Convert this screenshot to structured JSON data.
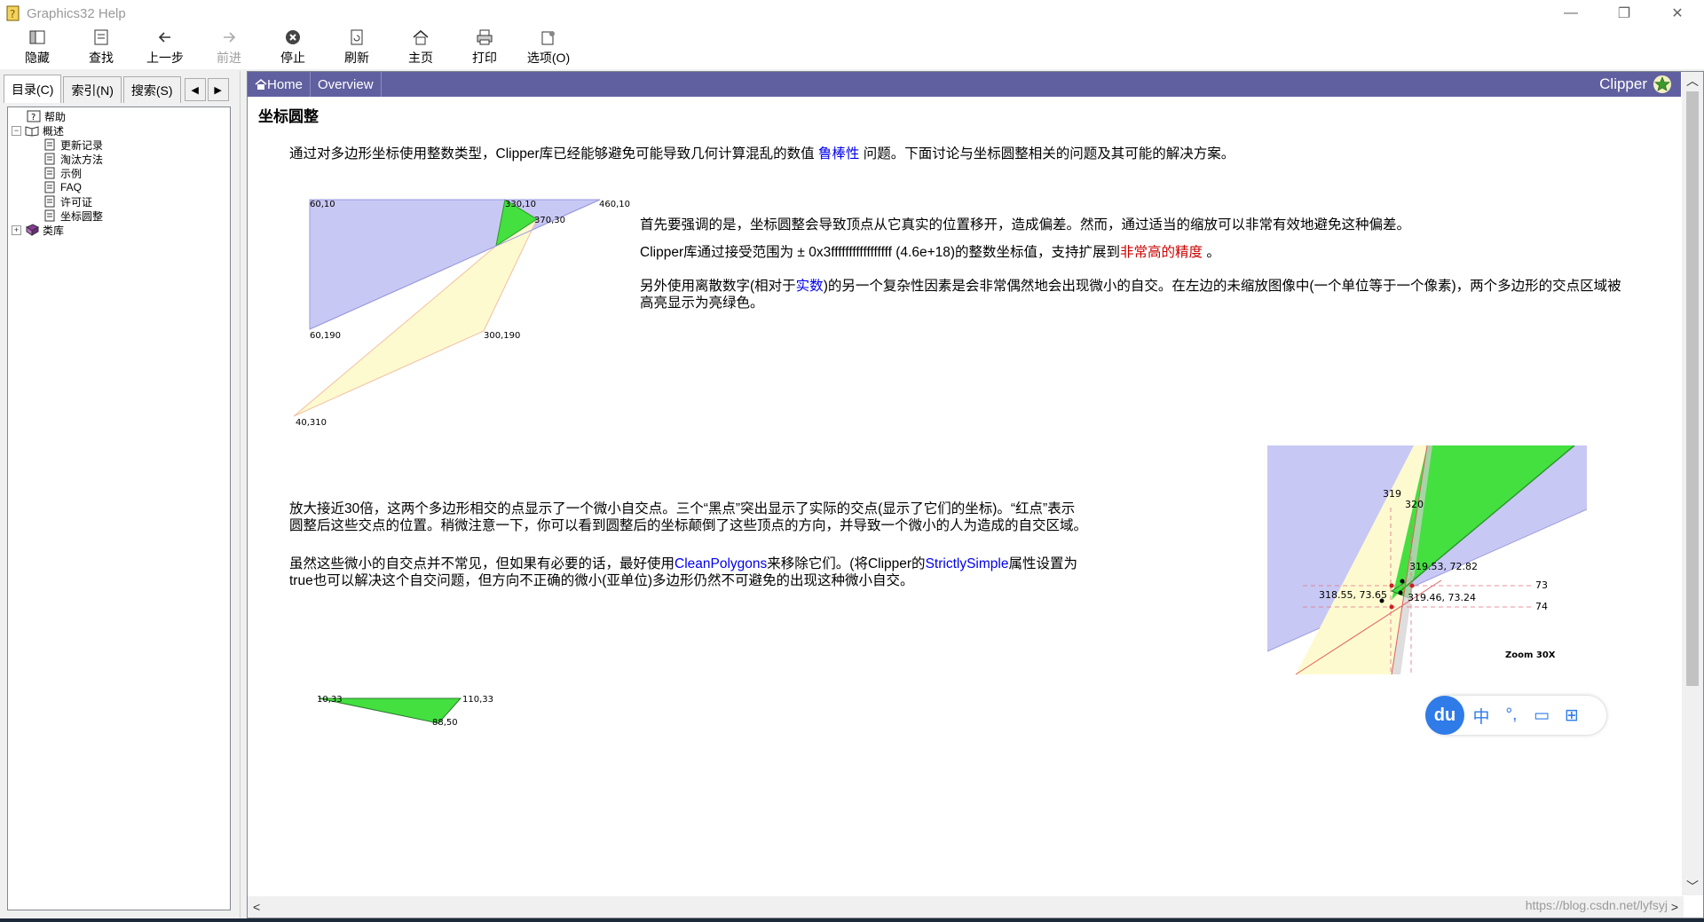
{
  "window": {
    "title": "Graphics32 Help",
    "controls": [
      "—",
      "❐",
      "✕"
    ]
  },
  "toolbar": {
    "buttons": [
      {
        "label": "隐藏",
        "icon": "hide-icon",
        "enabled": true
      },
      {
        "label": "查找",
        "icon": "find-icon",
        "enabled": true
      },
      {
        "label": "上一步",
        "icon": "back-arrow-icon",
        "enabled": true
      },
      {
        "label": "前进",
        "icon": "forward-arrow-icon",
        "enabled": false
      },
      {
        "label": "停止",
        "icon": "stop-icon",
        "enabled": true
      },
      {
        "label": "刷新",
        "icon": "refresh-icon",
        "enabled": true
      },
      {
        "label": "主页",
        "icon": "home-icon",
        "enabled": true
      },
      {
        "label": "打印",
        "icon": "print-icon",
        "enabled": true
      },
      {
        "label": "选项(O)",
        "icon": "options-icon",
        "enabled": true
      }
    ]
  },
  "sidebar": {
    "tabs": [
      {
        "label": "目录(C)",
        "active": true
      },
      {
        "label": "索引(N)",
        "active": false
      },
      {
        "label": "搜索(S)",
        "active": false
      }
    ],
    "tree": [
      {
        "label": "帮助",
        "level": 0,
        "expander": "",
        "icon": "help-book-icon"
      },
      {
        "label": "概述",
        "level": 0,
        "expander": "−",
        "icon": "open-book-icon"
      },
      {
        "label": "更新记录",
        "level": 1,
        "expander": "",
        "icon": "page-icon"
      },
      {
        "label": "淘汰方法",
        "level": 1,
        "expander": "",
        "icon": "page-icon"
      },
      {
        "label": "示例",
        "level": 1,
        "expander": "",
        "icon": "page-icon"
      },
      {
        "label": "FAQ",
        "level": 1,
        "expander": "",
        "icon": "page-icon"
      },
      {
        "label": "许可证",
        "level": 1,
        "expander": "",
        "icon": "page-icon"
      },
      {
        "label": "坐标圆整",
        "level": 1,
        "expander": "",
        "icon": "page-icon"
      },
      {
        "label": "类库",
        "level": 0,
        "expander": "+",
        "icon": "library-book-icon"
      }
    ]
  },
  "content": {
    "nav": {
      "home": "Home",
      "overview": "Overview",
      "brand": "Clipper"
    },
    "title": "坐标圆整",
    "intro": {
      "before": "通过对多边形坐标使用整数类型，Clipper库已经能够避免可能导致几何计算混乱的数值 ",
      "link": "鲁棒性",
      "after": " 问题。下面讨论与坐标圆整相关的问题及其可能的解决方案。"
    },
    "p1": "首先要强调的是，坐标圆整会导致顶点从它真实的位置移开，造成偏差。然而，通过适当的缩放可以非常有效地避免这种偏差。",
    "p2": {
      "before": "Clipper库通过接受范围为 ± 0x3fffffffffffffffff (4.6e+18)的整数坐标值，支持扩展到",
      "link": "非常高的精度",
      "after": " 。"
    },
    "p3": {
      "before": "另外使用离散数字(相对于",
      "link": "实数",
      "after": ")的另一个复杂性因素是会非常偶然地会出现微小的自交。在左边的未缩放图像中(一个单位等于一个像素)，两个多边形的交点区域被高亮显示为亮绿色。"
    },
    "p4": "放大接近30倍，这两个多边形相交的点显示了一个微小自交点。三个“黑点”突出显示了实际的交点(显示了它们的坐标)。“红点”表示圆整后这些交点的位置。稍微注意一下，你可以看到圆整后的坐标颠倒了这些顶点的方向，并导致一个微小的人为造成的自交区域。",
    "p5": {
      "before": "虽然这些微小的自交点并不常见，但如果有必要的话，最好使用",
      "link1": "CleanPolygons",
      "mid": "来移除它们。(将Clipper的",
      "link2": "StrictlySimple",
      "after": "属性设置为true也可以解决这个自交问题，但方向不正确的微小(亚单位)多边形仍然不可避免的出现这种微小自交。"
    },
    "fig1_labels": [
      "60,10",
      "330,10",
      "370,30",
      "460,10",
      "60,190",
      "300,190",
      "40,310"
    ],
    "fig2_labels": {
      "l319": "319",
      "l320": "320",
      "a": "319.53, 72.82",
      "b": "318.55, 73.65",
      "c": "319.46, 73.24",
      "l73": "73",
      "l74": "74",
      "zoom": "Zoom 30X"
    },
    "fig3_labels": [
      "10,33",
      "110,33",
      "88,50"
    ],
    "watermark": "https://blog.csdn.net/lyfsyj",
    "du_bar": {
      "logo": "du",
      "items": [
        "中",
        "°,",
        "▭",
        "⊞"
      ]
    }
  },
  "colors": {
    "navbar": "#6060a0",
    "poly_blue": "#c8c8f4",
    "poly_yellow": "#fefad0",
    "poly_green": "#44e040"
  }
}
